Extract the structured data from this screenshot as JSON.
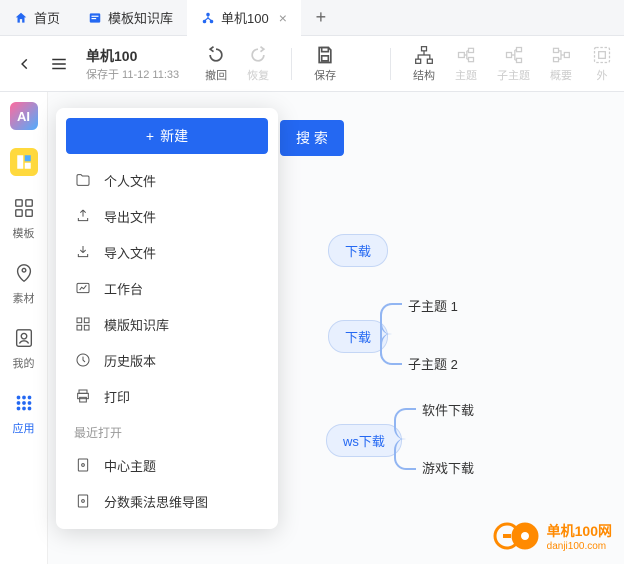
{
  "tabs": [
    {
      "label": "首页",
      "icon": "home"
    },
    {
      "label": "模板知识库",
      "icon": "library"
    },
    {
      "label": "单机100",
      "icon": "mindmap",
      "active": true
    }
  ],
  "doc": {
    "title": "单机100",
    "saved_at": "保存于 11-12 11:33"
  },
  "toolbar": {
    "undo": "撤回",
    "redo": "恢复",
    "save": "保存",
    "structure": "结构",
    "theme": "主题",
    "subtheme": "子主题",
    "summary": "概要",
    "outer": "外"
  },
  "rail": {
    "templates": "模板",
    "assets": "素材",
    "my": "我的",
    "apps": "应用"
  },
  "search_label": "搜 索",
  "dropdown": {
    "new": "新建",
    "personal": "个人文件",
    "export": "导出文件",
    "import": "导入文件",
    "workbench": "工作台",
    "template_lib": "模版知识库",
    "history": "历史版本",
    "print": "打印",
    "recent_header": "最近打开",
    "recent": [
      "中心主题",
      "分数乘法思维导图"
    ]
  },
  "nodes": {
    "n1": "下载",
    "n2": "下载",
    "n3": "ws下载",
    "leaf1": "子主题 1",
    "leaf2": "子主题 2",
    "leaf3": "软件下载",
    "leaf4": "游戏下载"
  },
  "watermark": {
    "title": "单机100网",
    "sub": "danji100.com"
  }
}
